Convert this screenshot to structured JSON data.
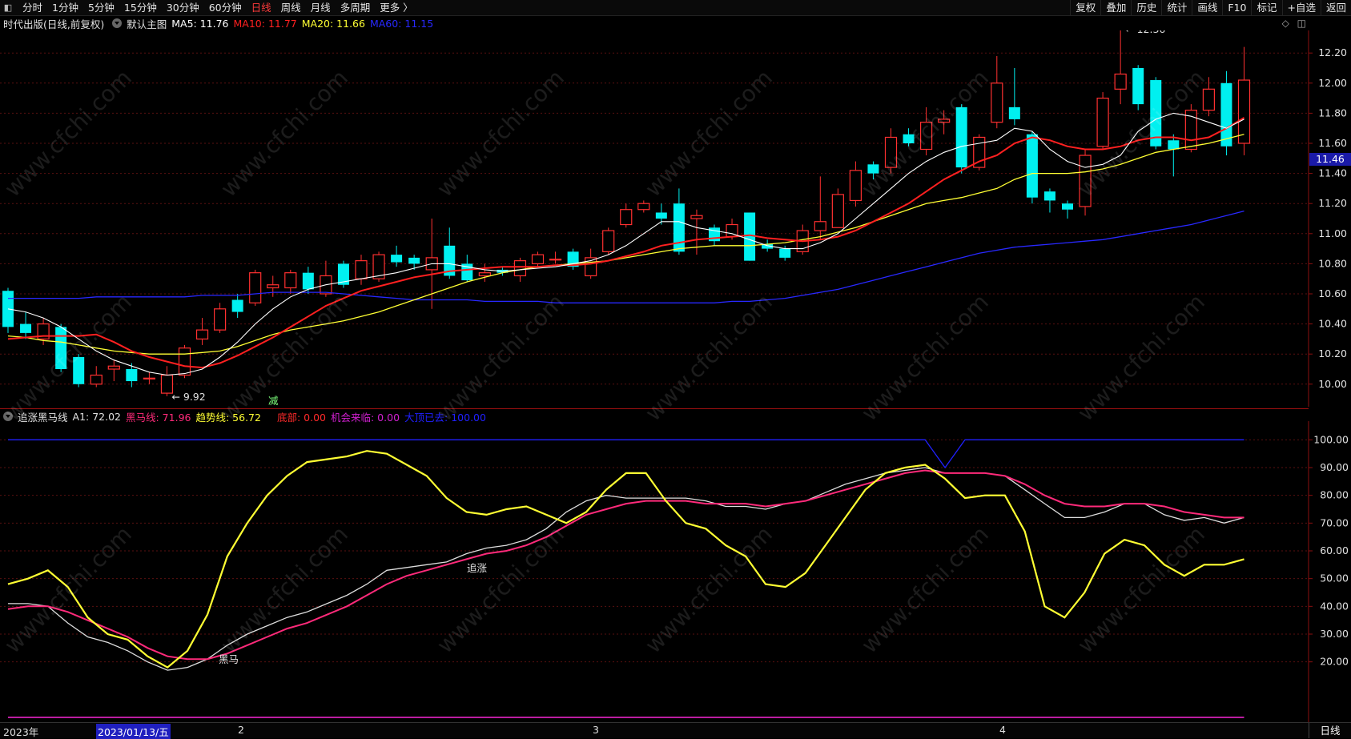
{
  "topbar": {
    "tabs": [
      "分时",
      "1分钟",
      "5分钟",
      "15分钟",
      "30分钟",
      "60分钟",
      "日线",
      "周线",
      "月线",
      "多周期",
      "更多 〉"
    ],
    "active_tab": "日线",
    "right_tabs": [
      "复权",
      "叠加",
      "历史",
      "统计",
      "画线",
      "F10",
      "标记",
      "+自选",
      "返回"
    ]
  },
  "main_legend": {
    "stock": "时代出版(日线,前复权)",
    "template": "默认主图",
    "ma5": "MA5: 11.76",
    "ma10": "MA10: 11.77",
    "ma20": "MA20: 11.66",
    "ma60": "MA60: 11.15",
    "colors": {
      "ma5": "#ffffff",
      "ma10": "#ff2020",
      "ma20": "#ffff33",
      "ma60": "#2828ff"
    }
  },
  "indicator_legend": {
    "name": "追涨黑马线",
    "a1": "A1: 72.02",
    "heima": "黑马线: 71.96",
    "trend": "趋势线: 56.72",
    "bottom": "底部: 0.00",
    "chance": "机会来临: 0.00",
    "top": "大顶已去: 100.00"
  },
  "annotations": {
    "high": "12.36",
    "low": "9.92",
    "jian": "减",
    "zhuizhang": "追涨",
    "heima": "黑马"
  },
  "current_price": "11.46",
  "bottom_bar": {
    "year": "2023年",
    "date": "2023/01/13/五",
    "feb": "2",
    "mar": "3",
    "apr": "4",
    "period": "日线"
  },
  "watermark_text": "www.cfchi.com",
  "chart_data": [
    {
      "type": "candlestick",
      "title": "时代出版(日线,前复权)",
      "ylim": [
        9.85,
        12.35
      ],
      "yticks": [
        "10.00",
        "10.20",
        "10.40",
        "10.60",
        "10.80",
        "11.00",
        "11.20",
        "11.40",
        "11.60",
        "11.80",
        "12.00",
        "12.20"
      ],
      "candles": [
        [
          10.62,
          10.38,
          10.64,
          10.34
        ],
        [
          10.4,
          10.34,
          10.48,
          10.3
        ],
        [
          10.3,
          10.4,
          10.44,
          10.26
        ],
        [
          10.38,
          10.1,
          10.4,
          10.08
        ],
        [
          10.18,
          10.0,
          10.2,
          9.98
        ],
        [
          10.0,
          10.06,
          10.12,
          9.98
        ],
        [
          10.1,
          10.12,
          10.16,
          10.02
        ],
        [
          10.1,
          10.02,
          10.14,
          9.98
        ],
        [
          10.04,
          10.04,
          10.08,
          10.0
        ],
        [
          9.94,
          10.06,
          10.12,
          9.92
        ],
        [
          10.06,
          10.24,
          10.26,
          10.04
        ],
        [
          10.3,
          10.36,
          10.44,
          10.26
        ],
        [
          10.36,
          10.5,
          10.54,
          10.34
        ],
        [
          10.56,
          10.48,
          10.6,
          10.44
        ],
        [
          10.54,
          10.74,
          10.76,
          10.52
        ],
        [
          10.64,
          10.66,
          10.72,
          10.58
        ],
        [
          10.64,
          10.74,
          10.76,
          10.6
        ],
        [
          10.74,
          10.63,
          10.78,
          10.6
        ],
        [
          10.6,
          10.72,
          10.82,
          10.58
        ],
        [
          10.8,
          10.66,
          10.82,
          10.64
        ],
        [
          10.7,
          10.82,
          10.86,
          10.66
        ],
        [
          10.7,
          10.86,
          10.88,
          10.68
        ],
        [
          10.86,
          10.81,
          10.92,
          10.78
        ],
        [
          10.84,
          10.8,
          10.86,
          10.76
        ],
        [
          10.76,
          10.84,
          11.1,
          10.5
        ],
        [
          10.92,
          10.72,
          11.04,
          10.7
        ],
        [
          10.8,
          10.69,
          10.86,
          10.68
        ],
        [
          10.72,
          10.74,
          10.8,
          10.68
        ],
        [
          10.76,
          10.74,
          10.78,
          10.72
        ],
        [
          10.72,
          10.82,
          10.84,
          10.68
        ],
        [
          10.8,
          10.86,
          10.88,
          10.78
        ],
        [
          10.83,
          10.83,
          10.88,
          10.8
        ],
        [
          10.88,
          10.78,
          10.9,
          10.76
        ],
        [
          10.72,
          10.84,
          10.9,
          10.7
        ],
        [
          10.88,
          11.02,
          11.04,
          10.86
        ],
        [
          11.06,
          11.16,
          11.2,
          11.04
        ],
        [
          11.16,
          11.2,
          11.22,
          11.14
        ],
        [
          11.14,
          11.1,
          11.2,
          11.06
        ],
        [
          11.2,
          10.88,
          11.3,
          10.86
        ],
        [
          11.1,
          11.12,
          11.16,
          10.86
        ],
        [
          11.04,
          10.95,
          11.06,
          10.92
        ],
        [
          10.98,
          11.06,
          11.1,
          10.96
        ],
        [
          11.14,
          10.82,
          11.14,
          10.82
        ],
        [
          10.93,
          10.9,
          10.96,
          10.88
        ],
        [
          10.9,
          10.84,
          10.92,
          10.82
        ],
        [
          10.88,
          11.02,
          11.06,
          10.86
        ],
        [
          11.02,
          11.08,
          11.38,
          10.96
        ],
        [
          11.04,
          11.26,
          11.3,
          11.04
        ],
        [
          11.22,
          11.42,
          11.48,
          11.18
        ],
        [
          11.46,
          11.4,
          11.48,
          11.36
        ],
        [
          11.44,
          11.64,
          11.7,
          11.4
        ],
        [
          11.66,
          11.6,
          11.7,
          11.58
        ],
        [
          11.56,
          11.74,
          11.84,
          11.52
        ],
        [
          11.74,
          11.76,
          11.82,
          11.66
        ],
        [
          11.84,
          11.44,
          11.86,
          11.4
        ],
        [
          11.44,
          11.64,
          11.66,
          11.42
        ],
        [
          11.74,
          12.0,
          12.18,
          11.7
        ],
        [
          11.84,
          11.76,
          12.1,
          11.72
        ],
        [
          11.66,
          11.24,
          11.68,
          11.2
        ],
        [
          11.28,
          11.22,
          11.3,
          11.14
        ],
        [
          11.2,
          11.16,
          11.22,
          11.1
        ],
        [
          11.18,
          11.52,
          11.56,
          11.12
        ],
        [
          11.58,
          11.9,
          11.94,
          11.56
        ],
        [
          11.96,
          12.06,
          12.36,
          11.86
        ],
        [
          12.1,
          11.86,
          12.12,
          11.82
        ],
        [
          12.02,
          11.58,
          12.04,
          11.56
        ],
        [
          11.62,
          11.56,
          11.66,
          11.38
        ],
        [
          11.56,
          11.82,
          11.86,
          11.54
        ],
        [
          11.82,
          11.96,
          12.04,
          11.78
        ],
        [
          12.0,
          11.58,
          12.08,
          11.52
        ],
        [
          11.6,
          12.02,
          12.24,
          11.52
        ]
      ],
      "ma5": [
        10.5,
        10.48,
        10.44,
        10.38,
        10.3,
        10.22,
        10.16,
        10.12,
        10.08,
        10.06,
        10.07,
        10.1,
        10.18,
        10.28,
        10.4,
        10.5,
        10.58,
        10.63,
        10.66,
        10.68,
        10.7,
        10.72,
        10.74,
        10.77,
        10.8,
        10.8,
        10.78,
        10.76,
        10.75,
        10.76,
        10.77,
        10.78,
        10.8,
        10.82,
        10.86,
        10.92,
        11.0,
        11.08,
        11.08,
        11.04,
        11.02,
        11.0,
        10.96,
        10.92,
        10.9,
        10.9,
        10.94,
        11.0,
        11.1,
        11.2,
        11.3,
        11.4,
        11.48,
        11.54,
        11.58,
        11.6,
        11.62,
        11.7,
        11.68,
        11.56,
        11.48,
        11.44,
        11.46,
        11.52,
        11.68,
        11.76,
        11.8,
        11.78,
        11.74,
        11.7,
        11.76
      ],
      "ma10": [
        10.3,
        10.31,
        10.32,
        10.32,
        10.32,
        10.33,
        10.28,
        10.22,
        10.18,
        10.15,
        10.12,
        10.11,
        10.14,
        10.19,
        10.25,
        10.31,
        10.38,
        10.45,
        10.52,
        10.57,
        10.62,
        10.65,
        10.68,
        10.71,
        10.73,
        10.75,
        10.76,
        10.77,
        10.78,
        10.78,
        10.78,
        10.79,
        10.79,
        10.8,
        10.82,
        10.85,
        10.88,
        10.92,
        10.94,
        10.96,
        10.97,
        10.98,
        10.99,
        10.97,
        10.96,
        10.95,
        10.96,
        10.98,
        11.02,
        11.08,
        11.14,
        11.2,
        11.28,
        11.36,
        11.42,
        11.48,
        11.52,
        11.6,
        11.64,
        11.62,
        11.58,
        11.56,
        11.56,
        11.58,
        11.62,
        11.64,
        11.64,
        11.62,
        11.64,
        11.7,
        11.77
      ],
      "ma20": [
        10.32,
        10.31,
        10.29,
        10.28,
        10.26,
        10.24,
        10.22,
        10.21,
        10.2,
        10.2,
        10.2,
        10.21,
        10.22,
        10.25,
        10.29,
        10.33,
        10.36,
        10.38,
        10.4,
        10.42,
        10.45,
        10.48,
        10.52,
        10.56,
        10.6,
        10.64,
        10.68,
        10.71,
        10.74,
        10.76,
        10.78,
        10.79,
        10.8,
        10.81,
        10.82,
        10.84,
        10.86,
        10.88,
        10.9,
        10.91,
        10.92,
        10.92,
        10.92,
        10.93,
        10.94,
        10.96,
        10.98,
        11.01,
        11.04,
        11.08,
        11.12,
        11.16,
        11.2,
        11.22,
        11.24,
        11.27,
        11.3,
        11.36,
        11.4,
        11.4,
        11.4,
        11.41,
        11.43,
        11.46,
        11.5,
        11.54,
        11.56,
        11.58,
        11.6,
        11.63,
        11.66
      ],
      "ma60": [
        10.57,
        10.57,
        10.57,
        10.57,
        10.57,
        10.58,
        10.58,
        10.58,
        10.58,
        10.58,
        10.58,
        10.59,
        10.59,
        10.59,
        10.6,
        10.61,
        10.61,
        10.61,
        10.61,
        10.6,
        10.59,
        10.58,
        10.57,
        10.56,
        10.56,
        10.56,
        10.56,
        10.55,
        10.55,
        10.55,
        10.55,
        10.54,
        10.54,
        10.54,
        10.54,
        10.54,
        10.54,
        10.54,
        10.54,
        10.54,
        10.54,
        10.55,
        10.55,
        10.56,
        10.57,
        10.59,
        10.61,
        10.63,
        10.66,
        10.69,
        10.72,
        10.75,
        10.78,
        10.81,
        10.84,
        10.87,
        10.89,
        10.91,
        10.92,
        10.93,
        10.94,
        10.95,
        10.96,
        10.98,
        11.0,
        11.02,
        11.04,
        11.06,
        11.09,
        11.12,
        11.15
      ]
    },
    {
      "type": "line",
      "title": "追涨黑马线",
      "ylim": [
        0,
        105
      ],
      "yticks": [
        "20.00",
        "30.00",
        "40.00",
        "50.00",
        "60.00",
        "70.00",
        "80.00",
        "90.00",
        "100.00"
      ],
      "series": [
        {
          "name": "A1",
          "color": "#dddddd",
          "values": [
            41,
            41,
            40,
            34,
            29,
            27,
            24,
            20,
            17,
            18,
            21,
            26,
            30,
            33,
            36,
            38,
            41,
            44,
            48,
            53,
            54,
            55,
            56,
            59,
            61,
            62,
            64,
            68,
            74,
            78,
            80,
            79,
            79,
            79,
            79,
            78,
            76,
            76,
            75,
            77,
            78,
            81,
            84,
            86,
            88,
            89,
            90,
            88,
            88,
            88,
            87,
            82,
            77,
            72,
            72,
            74,
            77,
            77,
            73,
            71,
            72,
            70,
            72
          ]
        },
        {
          "name": "黑马线",
          "color": "#ff2a7a",
          "values": [
            39,
            40,
            40,
            38,
            35,
            32,
            29,
            25,
            22,
            21,
            21,
            23,
            26,
            29,
            32,
            34,
            37,
            40,
            44,
            48,
            51,
            53,
            55,
            57,
            59,
            60,
            62,
            65,
            69,
            73,
            75,
            77,
            78,
            78,
            78,
            77,
            77,
            77,
            76,
            77,
            78,
            80,
            82,
            84,
            86,
            88,
            89,
            88,
            88,
            88,
            87,
            84,
            80,
            77,
            76,
            76,
            77,
            77,
            76,
            74,
            73,
            72,
            72
          ]
        },
        {
          "name": "趋势线",
          "color": "#ffff33",
          "values": [
            48,
            50,
            53,
            47,
            36,
            30,
            28,
            22,
            18,
            24,
            37,
            58,
            70,
            80,
            87,
            92,
            93,
            94,
            96,
            95,
            91,
            87,
            79,
            74,
            73,
            75,
            76,
            73,
            70,
            74,
            82,
            88,
            88,
            78,
            70,
            68,
            62,
            58,
            48,
            47,
            52,
            62,
            72,
            82,
            88,
            90,
            91,
            86,
            79,
            80,
            80,
            67,
            40,
            36,
            45,
            59,
            64,
            62,
            55,
            51,
            55,
            55,
            57
          ]
        },
        {
          "name": "大顶已去",
          "color": "#2020ff",
          "values": [
            100,
            100,
            100,
            100,
            100,
            100,
            100,
            100,
            100,
            100,
            100,
            100,
            100,
            100,
            100,
            100,
            100,
            100,
            100,
            100,
            100,
            100,
            100,
            100,
            100,
            100,
            100,
            100,
            100,
            100,
            100,
            100,
            100,
            100,
            100,
            100,
            100,
            100,
            100,
            100,
            100,
            100,
            100,
            100,
            100,
            100,
            100,
            90,
            100,
            100,
            100,
            100,
            100,
            100,
            100,
            100,
            100,
            100,
            100,
            100,
            100,
            100,
            100
          ]
        },
        {
          "name": "底部",
          "color": "#ff2a2a",
          "values": [
            0
          ]
        },
        {
          "name": "机会来临",
          "color": "#d020d0",
          "values": [
            0
          ]
        }
      ]
    }
  ]
}
